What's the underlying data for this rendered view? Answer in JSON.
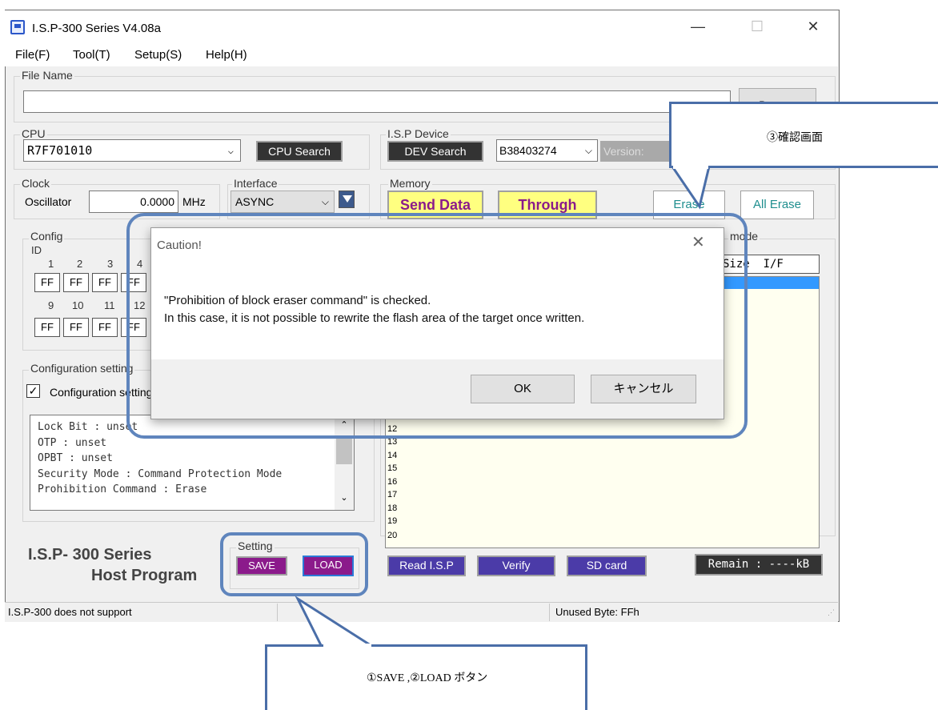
{
  "window": {
    "title": "I.S.P-300 Series V4.08a",
    "controls": {
      "minimize": "—",
      "maximize": "☐",
      "close": "✕"
    }
  },
  "menu": [
    "File(F)",
    "Tool(T)",
    "Setup(S)",
    "Help(H)"
  ],
  "file_name": {
    "label": "File Name",
    "value": "",
    "browse_label": "Browse"
  },
  "cpu": {
    "label": "CPU",
    "value": "R7F701010",
    "search_label": "CPU Search"
  },
  "isp_device": {
    "label": "I.S.P Device",
    "search_label": "DEV Search",
    "device_value": "B38403274",
    "version_label": "Version:"
  },
  "clock": {
    "label": "Clock",
    "oscillator_label": "Oscillator",
    "oscillator_value": "0.0000",
    "unit": "MHz"
  },
  "interface": {
    "label": "Interface",
    "value": "ASYNC"
  },
  "memory": {
    "label": "Memory",
    "send_data": "Send Data",
    "through": "Through",
    "erase": "Erase",
    "all_erase": "All Erase"
  },
  "config": {
    "label": "Config",
    "id_label": "ID",
    "row1_numbers": [
      "1",
      "2",
      "3",
      "4"
    ],
    "row1_values": [
      "FF",
      "FF",
      "FF",
      "FF"
    ],
    "row2_numbers": [
      "9",
      "10",
      "11",
      "12"
    ],
    "row2_values": [
      "FF",
      "FF",
      "FF",
      "FF"
    ]
  },
  "config_setting": {
    "label": "Configuration setting",
    "checkbox_label": "Configuration setting",
    "checked": true,
    "text_lines": [
      "Lock Bit : unset",
      "OTP : unset",
      "OPBT : unset",
      "Security Mode : Command Protection Mode",
      "Prohibition Command : Erase"
    ]
  },
  "right_panel": {
    "mode_label": "mode",
    "header": "Size  I/F",
    "rows": [
      "12",
      "13",
      "14",
      "15",
      "16",
      "17",
      "18",
      "19",
      "20"
    ]
  },
  "logo": {
    "line1": "I.S.P- 300  Series",
    "line2": "Host Program"
  },
  "setting": {
    "label": "Setting",
    "save": "SAVE",
    "load": "LOAD"
  },
  "bottom_buttons": {
    "read": "Read I.S.P",
    "verify": "Verify",
    "sd": "SD card",
    "remain": "Remain : ----kB"
  },
  "status": {
    "left": "I.S.P-300 does not support",
    "right": "Unused Byte: FFh"
  },
  "dialog": {
    "title": "Caution!",
    "line1": "\"Prohibition of block eraser command\" is checked.",
    "line2": "In this case, it is not possible to rewrite the flash area of the target once written.",
    "ok": "OK",
    "cancel": "キャンセル"
  },
  "callouts": {
    "confirm": "③確認画面",
    "buttons": "①SAVE ,②LOAD ボタン"
  },
  "colors": {
    "callout_border": "#4a6ea8",
    "send_bg": "#ffff80",
    "send_fg": "#8b1a8b",
    "purple_btn": "#4b3ba8"
  }
}
